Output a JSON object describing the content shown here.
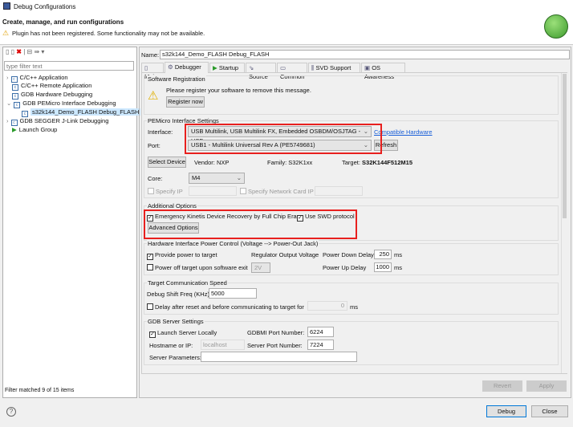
{
  "window": {
    "title": "Debug Configurations"
  },
  "header": {
    "title": "Create, manage, and run configurations",
    "warning": "Plugin has not been registered. Some functionality may not be available."
  },
  "left": {
    "filter_placeholder": "type filter text",
    "items": [
      {
        "label": "C/C++ Application",
        "expander": ">"
      },
      {
        "label": "C/C++ Remote Application",
        "expander": ""
      },
      {
        "label": "GDB Hardware Debugging",
        "expander": ""
      },
      {
        "label": "GDB PEMicro Interface Debugging",
        "expander": "v"
      },
      {
        "label": "s32k144_Demo_FLASH Debug_FLASH",
        "expander": "",
        "selected": true
      },
      {
        "label": "GDB SEGGER J-Link Debugging",
        "expander": ">"
      },
      {
        "label": "Launch Group",
        "expander": ""
      }
    ],
    "status": "Filter matched 9 of 15 items"
  },
  "name": {
    "label": "Name:",
    "value": "s32k144_Demo_FLASH Debug_FLASH"
  },
  "tabs": [
    "Main",
    "Debugger",
    "Startup",
    "Source",
    "Common",
    "SVD Support",
    "OS Awareness"
  ],
  "active_tab": "Debugger",
  "registration": {
    "title": "Software Registration",
    "message": "Please register your software to remove this message.",
    "button": "Register now"
  },
  "pemicro": {
    "title": "PEMicro Interface Settings",
    "interface_label": "Interface:",
    "interface_value": "USB Multilink, USB Multilink FX, Embedded OSBDM/OSJTAG - USB",
    "compat_link": "Compatible Hardware",
    "port_label": "Port:",
    "port_value": "USB1 - Multilink Universal Rev A (PE5749681)",
    "refresh": "Refresh",
    "select_device": "Select Device",
    "vendor": "Vendor: NXP",
    "family": "Family: S32K1xx",
    "target_label": "Target:",
    "target_value": "S32K144F512M15",
    "core_label": "Core:",
    "core_value": "M4",
    "specify_ip": "Specify IP",
    "specify_nic": "Specify Network Card IP"
  },
  "additional": {
    "title": "Additional Options",
    "emergency": "Emergency Kinetis Device Recovery by Full Chip Erase",
    "swd": "Use SWD protocol",
    "advanced": "Advanced Options"
  },
  "power": {
    "title": "Hardware Interface Power Control (Voltage --> Power-Out Jack)",
    "provide": "Provide power to target",
    "regulator": "Regulator Output Voltage",
    "down_label": "Power Down Delay",
    "down_value": "250",
    "ms": "ms",
    "poweroff": "Power off target upon software exit",
    "voltage": "2V",
    "up_label": "Power Up Delay",
    "up_value": "1000"
  },
  "speed": {
    "title": "Target Communication Speed",
    "freq_label": "Debug Shift Freq (KHz)",
    "freq_value": "5000",
    "delay": "Delay after reset and before communicating to target for",
    "delay_value": "0",
    "ms": "ms"
  },
  "gdb": {
    "title": "GDB Server Settings",
    "launch": "Launch Server Locally",
    "gdbmi_label": "GDBMI Port Number:",
    "gdbmi_value": "6224",
    "host_label": "Hostname or IP:",
    "host_value": "localhost",
    "server_port_label": "Server Port Number:",
    "server_port_value": "7224",
    "params_label": "Server Parameters:",
    "params_value": ""
  },
  "actions": {
    "revert": "Revert",
    "apply": "Apply",
    "debug": "Debug",
    "close": "Close"
  }
}
